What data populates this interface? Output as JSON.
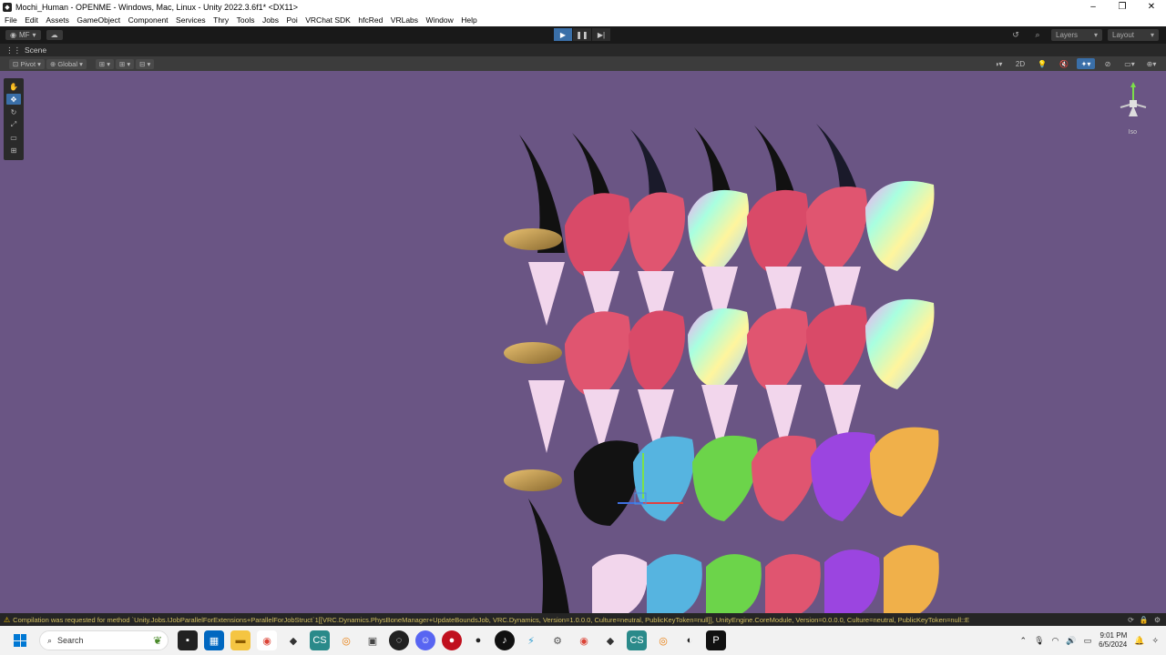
{
  "window": {
    "title": "Mochi_Human - OPENME - Windows, Mac, Linux - Unity 2022.3.6f1* <DX11>",
    "controls": [
      "–",
      "❐",
      "✕"
    ]
  },
  "menu": [
    "File",
    "Edit",
    "Assets",
    "GameObject",
    "Component",
    "Services",
    "Thry",
    "Tools",
    "Jobs",
    "Poi",
    "VRChat SDK",
    "hfcRed",
    "VRLabs",
    "Window",
    "Help"
  ],
  "toolbar": {
    "account": "MF",
    "layers": "Layers",
    "layout": "Layout"
  },
  "scene_tab": {
    "label": "Scene"
  },
  "scene_toolbar": {
    "pivot": "Pivot",
    "global": "Global",
    "mode_2d": "2D",
    "iso_label": "Iso"
  },
  "status": {
    "message": "Compilation was requested for method `Unity.Jobs.IJobParallelForExtensions+ParallelForJobStruct`1[[VRC.Dynamics.PhysBoneManager+UpdateBoundsJob, VRC.Dynamics, Version=1.0.0.0, Culture=neutral, PublicKeyToken=null]], UnityEngine.CoreModule, Version=0.0.0.0, Culture=neutral, PublicKeyToken=null::E"
  },
  "taskbar": {
    "search_placeholder": "Search",
    "time": "9:01 PM",
    "date": "6/5/2024"
  },
  "colors": {
    "scene_background": "#6a5584",
    "accent": "#3a6fa8",
    "taskbar": "#f2f2f2"
  }
}
